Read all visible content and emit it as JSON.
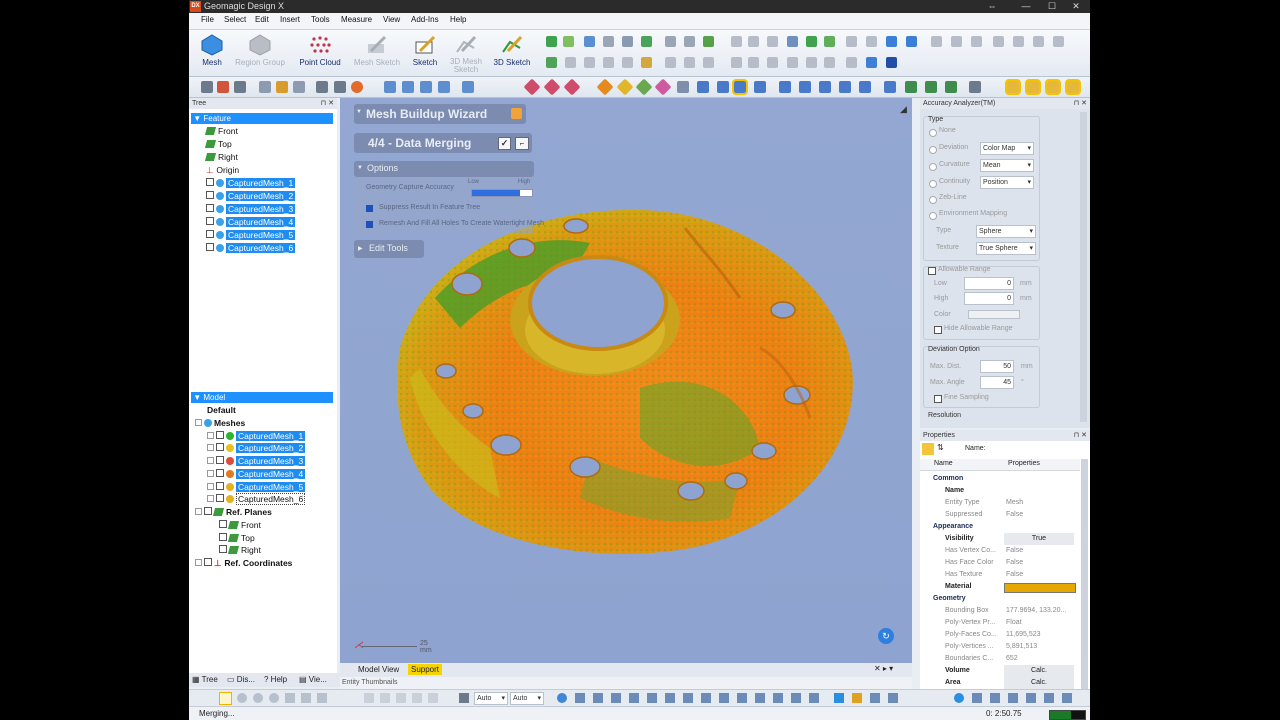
{
  "window": {
    "title": "Geomagic Design X",
    "logo": "DX"
  },
  "menu": [
    "File",
    "Select",
    "Edit",
    "Insert",
    "Tools",
    "Measure",
    "View",
    "Add-Ins",
    "Help"
  ],
  "ribbon": [
    {
      "label": "Mesh",
      "enabled": true,
      "icon": "mesh-icon"
    },
    {
      "label": "Region Group",
      "enabled": false,
      "icon": "region-group-icon"
    },
    {
      "label": "Point Cloud",
      "enabled": true,
      "icon": "point-cloud-icon"
    },
    {
      "label": "Mesh Sketch",
      "enabled": false,
      "icon": "mesh-sketch-icon"
    },
    {
      "label": "Sketch",
      "enabled": true,
      "icon": "sketch-icon"
    },
    {
      "label": "3D Mesh Sketch",
      "enabled": false,
      "icon": "3d-mesh-sketch-icon"
    },
    {
      "label": "3D Sketch",
      "enabled": true,
      "icon": "3d-sketch-icon"
    }
  ],
  "tree_panel": {
    "title": "Tree",
    "feature_header": "Feature",
    "feature_items": [
      "Front",
      "Top",
      "Right",
      "Origin"
    ],
    "captured_meshes": [
      "CapturedMesh_1",
      "CapturedMesh_2",
      "CapturedMesh_3",
      "CapturedMesh_4",
      "CapturedMesh_5",
      "CapturedMesh_6"
    ],
    "model_header": "Model",
    "model_default": "Default",
    "meshes_label": "Meshes",
    "model_meshes": [
      {
        "name": "CapturedMesh_1",
        "color": "#2db52d",
        "selected": true
      },
      {
        "name": "CapturedMesh_2",
        "color": "#e8c21c",
        "selected": true
      },
      {
        "name": "CapturedMesh_3",
        "color": "#e04a3a",
        "selected": true
      },
      {
        "name": "CapturedMesh_4",
        "color": "#e07a20",
        "selected": true
      },
      {
        "name": "CapturedMesh_5",
        "color": "#e6b020",
        "selected": true
      },
      {
        "name": "CapturedMesh_6",
        "color": "#e6b020",
        "selected": false
      }
    ],
    "ref_planes_label": "Ref. Planes",
    "ref_planes": [
      "Front",
      "Top",
      "Right"
    ],
    "ref_coords_label": "Ref. Coordinates",
    "bottom_tabs": [
      "Tree",
      "Dis...",
      "Help",
      "Vie..."
    ]
  },
  "wizard": {
    "title": "Mesh Buildup Wizard",
    "step": "4/4 - Data Merging",
    "options_label": "Options",
    "geometry_label": "Geometry Capture Accuracy",
    "slider_low": "Low",
    "slider_high": "High",
    "option1": "Suppress Result In Feature Tree",
    "option2": "Remesh And Fill All Holes To Create Watertight Mesh",
    "edit_tools": "Edit Tools"
  },
  "viewport": {
    "scale_label": "25 mm",
    "tabs": [
      "Model View",
      "Support"
    ],
    "entity_thumbnails": "Entity Thumbnails"
  },
  "accuracy": {
    "title": "Accuracy Analyzer(TM)",
    "type_label": "Type",
    "none": "None",
    "deviation": "Deviation",
    "deviation_value": "Color Map",
    "curvature": "Curvature",
    "curvature_value": "Mean",
    "continuity": "Continuity",
    "continuity_value": "Position",
    "zebra": "Zeb-Line",
    "env_mapping": "Environment Mapping",
    "type2_label": "Type",
    "type2_value": "Sphere",
    "texture_label": "Texture",
    "texture_value": "True Sphere",
    "allowable_range": "Allowable Range",
    "low_label": "Low",
    "low_value": "0",
    "high_label": "High",
    "high_value": "0",
    "unit": "mm",
    "color_label": "Color",
    "hide_range": "Hide Allowable Range",
    "deviation_option": "Deviation Option",
    "max_dist_label": "Max. Dist.",
    "max_dist_value": "50",
    "max_angle_label": "Max. Angle",
    "max_angle_value": "45",
    "deg_unit": "°",
    "fine_sampling": "Fine Sampling",
    "resolution": "Resolution"
  },
  "properties": {
    "title": "Properties",
    "name_label": "Name:",
    "col_name": "Name",
    "col_props": "Properties",
    "rows": [
      {
        "k": "Common",
        "v": "",
        "type": "cat"
      },
      {
        "k": "Name",
        "v": "",
        "type": "b"
      },
      {
        "k": "Entity Type",
        "v": "Mesh",
        "type": "n"
      },
      {
        "k": "Suppressed",
        "v": "False",
        "type": "n"
      },
      {
        "k": "Appearance",
        "v": "",
        "type": "cat"
      },
      {
        "k": "Visibility",
        "v": "True",
        "type": "b"
      },
      {
        "k": "Has Vertex Co...",
        "v": "False",
        "type": "n"
      },
      {
        "k": "Has Face Color",
        "v": "False",
        "type": "n"
      },
      {
        "k": "Has Texture",
        "v": "False",
        "type": "n"
      },
      {
        "k": "Material",
        "v": "",
        "type": "b"
      },
      {
        "k": "Geometry",
        "v": "",
        "type": "cat"
      },
      {
        "k": "Bounding Box",
        "v": "177.9694, 133.20...",
        "type": "n"
      },
      {
        "k": "Poly-Vertex Pr...",
        "v": "Float",
        "type": "n"
      },
      {
        "k": "Poly-Faces Co...",
        "v": "11,695,523",
        "type": "n"
      },
      {
        "k": "Poly-Vertices ...",
        "v": "5,891,513",
        "type": "n"
      },
      {
        "k": "Boundaries C...",
        "v": "652",
        "type": "n"
      },
      {
        "k": "Volume",
        "v": "Calc.",
        "type": "b"
      },
      {
        "k": "Area",
        "v": "Calc.",
        "type": "b"
      }
    ],
    "material_color": "#e6a800"
  },
  "bottom_toolbar": {
    "combo1": "Auto",
    "combo2": "Auto"
  },
  "status": {
    "text": "Merging...",
    "time": "0: 2:50.75"
  }
}
